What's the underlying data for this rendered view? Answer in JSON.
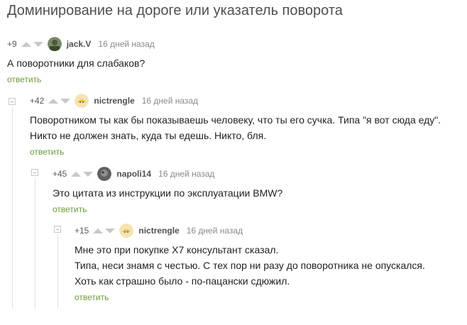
{
  "page": {
    "title": "Доминирование на дороге или указатель поворота"
  },
  "comments": [
    {
      "rating": "+9",
      "username": "jack.V",
      "time": "16 дней назад",
      "avatar": "jack-avatar",
      "text": [
        "А поворотники для слабаков?"
      ],
      "reply": "ответить"
    },
    {
      "rating": "+42",
      "username": "nictrengle",
      "time": "16 дней назад",
      "avatar": "nictrengle-avatar",
      "text": [
        "Поворотником ты как бы показываешь человеку, что ты его сучка. Типа \"я вот сюда еду\".",
        "Никто не должен знать, куда ты едешь. Никто, бля."
      ],
      "reply": "ответить"
    },
    {
      "rating": "+45",
      "username": "napoli14",
      "time": "16 дней назад",
      "avatar": "napoli-avatar",
      "text": [
        "Это цитата из инструкции по эксплуатации BMW?"
      ],
      "reply": "ответить"
    },
    {
      "rating": "+15",
      "username": "nictrengle",
      "time": "16 дней назад",
      "avatar": "nictrengle-avatar",
      "text": [
        "Мне это при покупке Х7 консультант сказал.",
        "Типа, неси знамя с честью. С тех пор ни разу до поворотника не опускался.",
        "Хоть как страшно было - по-пацански сдюжил."
      ],
      "reply": "ответить"
    }
  ],
  "colors": {
    "reply": "#6a9a3a",
    "arrow": "#c8c8c8",
    "title": "#505050"
  }
}
